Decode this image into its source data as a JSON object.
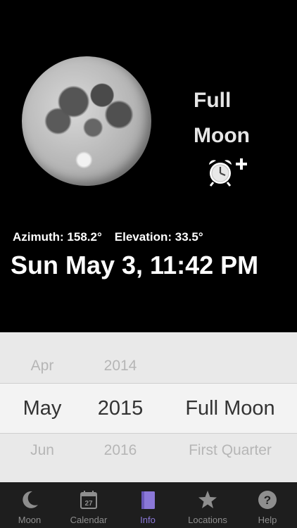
{
  "moon_display": {
    "phase_line1": "Full",
    "phase_line2": "Moon",
    "azimuth": "Azimuth: 158.2°",
    "elevation": "Elevation: 33.5°",
    "datetime": "Sun May 3, 11:42 PM"
  },
  "picker": {
    "prev": {
      "month": "Apr",
      "year": "2014",
      "phase": ""
    },
    "selected": {
      "month": "May",
      "year": "2015",
      "phase": "Full Moon"
    },
    "next": {
      "month": "Jun",
      "year": "2016",
      "phase": "First Quarter"
    }
  },
  "tabs": [
    {
      "label": "Moon",
      "icon": "moon-icon"
    },
    {
      "label": "Calendar",
      "icon": "calendar-icon",
      "badge": "27"
    },
    {
      "label": "Info",
      "icon": "book-icon",
      "active": true
    },
    {
      "label": "Locations",
      "icon": "star-icon"
    },
    {
      "label": "Help",
      "icon": "help-icon"
    }
  ],
  "colors": {
    "accent": "#8b78d8",
    "tabbar": "#1e1e1e",
    "picker_bg": "#e9e9e9"
  }
}
